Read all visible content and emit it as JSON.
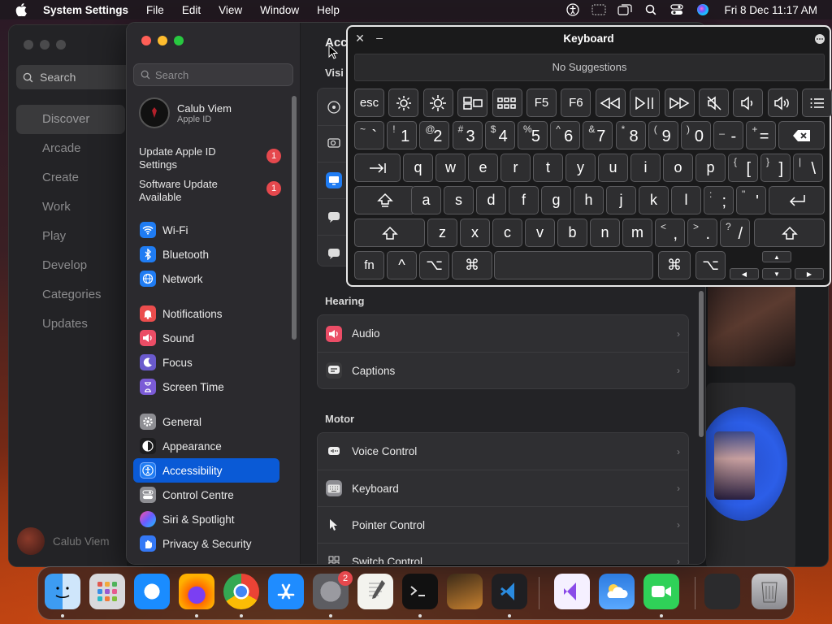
{
  "menubar": {
    "app_name": "System Settings",
    "menus": [
      "File",
      "Edit",
      "View",
      "Window",
      "Help"
    ],
    "datetime": "Fri 8 Dec  11:17 AM"
  },
  "store": {
    "search_label": "Search",
    "nav": [
      "Discover",
      "Arcade",
      "Create",
      "Work",
      "Play",
      "Develop",
      "Categories",
      "Updates"
    ],
    "selected_nav": "Discover",
    "user_name": "Calub Viem"
  },
  "settings": {
    "search_placeholder": "Search",
    "account": {
      "name": "Calub Viem",
      "subtitle": "Apple ID"
    },
    "notices": [
      {
        "label": "Update Apple ID Settings",
        "badge": "1"
      },
      {
        "label": "Software Update Available",
        "badge": "1"
      }
    ],
    "groups": [
      [
        {
          "label": "Wi-Fi",
          "icon": "wifi-icon",
          "color": "#1f7cf3"
        },
        {
          "label": "Bluetooth",
          "icon": "bluetooth-icon",
          "color": "#1f7cf3"
        },
        {
          "label": "Network",
          "icon": "globe-icon",
          "color": "#1f7cf3"
        }
      ],
      [
        {
          "label": "Notifications",
          "icon": "bell-icon",
          "color": "#eb4d4d"
        },
        {
          "label": "Sound",
          "icon": "speaker-icon",
          "color": "#eb4d66"
        },
        {
          "label": "Focus",
          "icon": "moon-icon",
          "color": "#6a5acd"
        },
        {
          "label": "Screen Time",
          "icon": "hourglass-icon",
          "color": "#7b5bd6"
        }
      ],
      [
        {
          "label": "General",
          "icon": "gear-icon",
          "color": "#8e8e93"
        },
        {
          "label": "Appearance",
          "icon": "appearance-icon",
          "color": "#1c1c1e"
        },
        {
          "label": "Accessibility",
          "icon": "accessibility-icon",
          "color": "#1f7cf3"
        },
        {
          "label": "Control Centre",
          "icon": "control-centre-icon",
          "color": "#8e8e93"
        },
        {
          "label": "Siri & Spotlight",
          "icon": "siri-icon",
          "color": "#c04fd8"
        },
        {
          "label": "Privacy & Security",
          "icon": "hand-icon",
          "color": "#3478f6"
        }
      ]
    ],
    "selected_item": "Accessibility",
    "page_title": "Acc",
    "vision_heading": "Visi",
    "sections": [
      {
        "heading": "Hearing",
        "rows": [
          {
            "label": "Audio",
            "icon": "audio-icon",
            "color": "#eb4d66"
          },
          {
            "label": "Captions",
            "icon": "captions-icon",
            "color": "#3a3a3c"
          }
        ]
      },
      {
        "heading": "Motor",
        "rows": [
          {
            "label": "Voice Control",
            "icon": "voice-control-icon",
            "color": "#3a3a3c"
          },
          {
            "label": "Keyboard",
            "icon": "keyboard-icon",
            "color": "#8e8e93"
          },
          {
            "label": "Pointer Control",
            "icon": "pointer-icon",
            "color": "#3a3a3c"
          },
          {
            "label": "Switch Control",
            "icon": "switch-control-icon",
            "color": "#3a3a3c"
          }
        ]
      }
    ]
  },
  "keyboard": {
    "title": "Keyboard",
    "suggestions": "No Suggestions",
    "fn_row": [
      "esc",
      "brightness-down-icon",
      "brightness-up-icon",
      "mission-control-icon",
      "launchpad-icon",
      "F5",
      "F6",
      "rewind-icon",
      "play-pause-icon",
      "fast-forward-icon",
      "mute-icon",
      "volume-down-icon",
      "volume-up-icon",
      "list-icon"
    ],
    "number_row": [
      [
        "~",
        "`"
      ],
      [
        "!",
        "1"
      ],
      [
        "@",
        "2"
      ],
      [
        "#",
        "3"
      ],
      [
        "$",
        "4"
      ],
      [
        "%",
        "5"
      ],
      [
        "^",
        "6"
      ],
      [
        "&",
        "7"
      ],
      [
        "*",
        "8"
      ],
      [
        "(",
        "9"
      ],
      [
        ")",
        "0"
      ],
      [
        "_",
        "-"
      ],
      [
        "+",
        "="
      ]
    ],
    "qwerty_row": [
      "q",
      "w",
      "e",
      "r",
      "t",
      "y",
      "u",
      "i",
      "o",
      "p"
    ],
    "qwerty_extra": [
      [
        "{",
        "["
      ],
      [
        "}",
        "]"
      ],
      [
        "|",
        "\\"
      ]
    ],
    "home_row": [
      "a",
      "s",
      "d",
      "f",
      "g",
      "h",
      "j",
      "k",
      "l"
    ],
    "home_extra": [
      [
        ":",
        ";"
      ],
      [
        "\"",
        "'"
      ]
    ],
    "bottom_row": [
      "z",
      "x",
      "c",
      "v",
      "b",
      "n",
      "m"
    ],
    "bottom_extra": [
      [
        "<",
        ","
      ],
      [
        ">",
        "."
      ],
      [
        "?",
        "/"
      ]
    ],
    "modifiers": {
      "fn": "fn",
      "control": "^",
      "option": "⌥",
      "command": "⌘"
    }
  },
  "dock": {
    "apps": [
      "Finder",
      "Launchpad",
      "Safari",
      "Firefox",
      "Chrome",
      "App Store",
      "System Settings",
      "TextEdit",
      "Terminal",
      "GarageBand",
      "VS Code",
      "Visual Studio",
      "Weather",
      "FaceTime",
      "Screen Capture",
      "Trash"
    ],
    "settings_badge": "2"
  }
}
